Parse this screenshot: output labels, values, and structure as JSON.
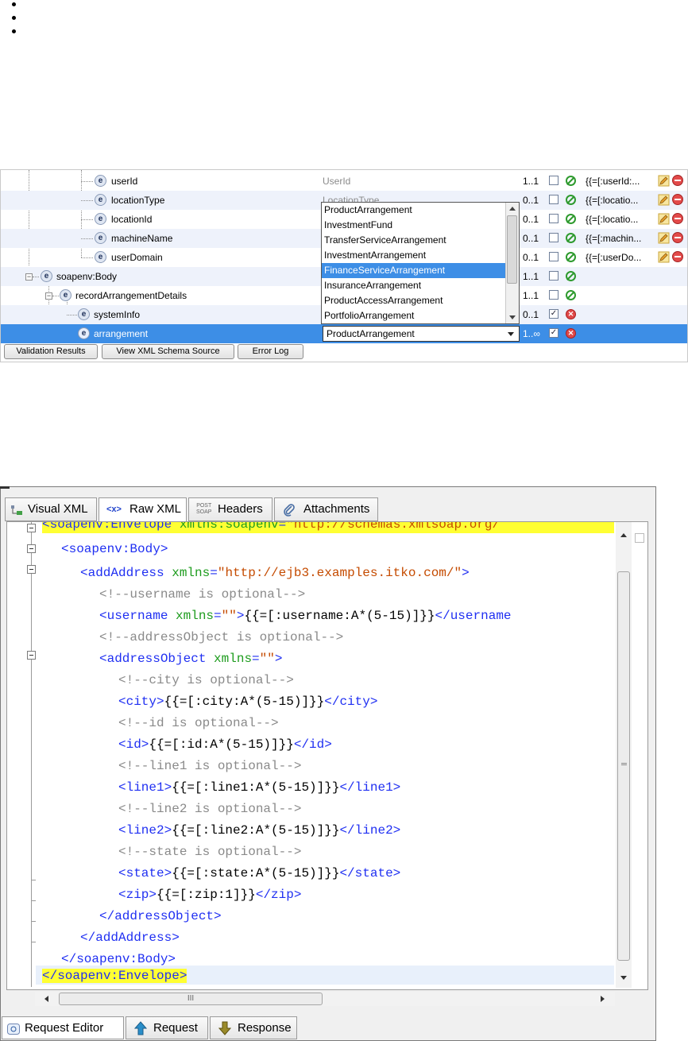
{
  "tree": {
    "rows": [
      {
        "name": "userId",
        "type": "UserId",
        "card": "1..1",
        "checked": false,
        "status": "ok",
        "value": "{{=[:userId:..."
      },
      {
        "name": "locationType",
        "type": "LocationType",
        "card": "0..1",
        "checked": false,
        "status": "ok",
        "value": "{{=[:locatio..."
      },
      {
        "name": "locationId",
        "type": "",
        "card": "0..1",
        "checked": false,
        "status": "ok",
        "value": "{{=[:locatio..."
      },
      {
        "name": "machineName",
        "type": "",
        "card": "0..1",
        "checked": false,
        "status": "ok",
        "value": "{{=[:machin..."
      },
      {
        "name": "userDomain",
        "type": "",
        "card": "0..1",
        "checked": false,
        "status": "ok",
        "value": "{{=[:userDo..."
      },
      {
        "name": "soapenv:Body",
        "type": "",
        "card": "1..1",
        "checked": false,
        "status": "ok",
        "value": ""
      },
      {
        "name": "recordArrangementDetails",
        "type": "",
        "card": "1..1",
        "checked": false,
        "status": "ok",
        "value": ""
      },
      {
        "name": "systemInfo",
        "type": "",
        "card": "0..1",
        "checked": true,
        "status": "error",
        "value": ""
      },
      {
        "name": "arrangement",
        "type": "",
        "card": "1..∞",
        "checked": true,
        "status": "error",
        "value": ""
      }
    ],
    "badge": "e",
    "dropdown": {
      "options": [
        "ProductArrangement",
        "InvestmentFund",
        "TransferServiceArrangement",
        "InvestmentArrangement",
        "FinanceServiceArrangement",
        "InsuranceArrangement",
        "ProductAccessArrangement",
        "PortfolioArrangement"
      ],
      "highlighted": "FinanceServiceArrangement",
      "selected": "ProductArrangement"
    },
    "buttons": {
      "validation": "Validation Results",
      "schema": "View XML Schema Source",
      "errorlog": "Error Log"
    }
  },
  "editor": {
    "tabs": {
      "visual": "Visual XML",
      "raw": "Raw XML",
      "headers": "Headers",
      "attachments": "Attachments",
      "raw_icon": "<x>",
      "headers_icon_top": "POST",
      "headers_icon_bottom": "SOAP"
    },
    "active_tab": "Raw XML",
    "lines": {
      "l1a": "<soapenv:Envelope ",
      "l1b": "xmlns:soapenv",
      "l1c": "=",
      "l1d": "\"http://schemas.xmlsoap.org/",
      "l2": "<soapenv:Body>",
      "l3a": "<addAddress ",
      "l3b": "xmlns",
      "l3c": "=",
      "l3d": "\"http://ejb3.examples.itko.com/\"",
      "l3e": ">",
      "l4": "<!--username is optional-->",
      "l5a": "<username ",
      "l5b": "xmlns",
      "l5c": "=",
      "l5d": "\"\"",
      "l5e": ">",
      "l5f": "{{=[:username:A*(5-15)]}}",
      "l5g": "</username",
      "l6": "<!--addressObject is optional-->",
      "l7a": "<addressObject ",
      "l7b": "xmlns",
      "l7c": "=",
      "l7d": "\"\"",
      "l7e": ">",
      "l8": "<!--city is optional-->",
      "l9a": "<city>",
      "l9b": "{{=[:city:A*(5-15)]}}",
      "l9c": "</city>",
      "l10": "<!--id is optional-->",
      "l11a": "<id>",
      "l11b": "{{=[:id:A*(5-15)]}}",
      "l11c": "</id>",
      "l12": "<!--line1 is optional-->",
      "l13a": "<line1>",
      "l13b": "{{=[:line1:A*(5-15)]}}",
      "l13c": "</line1>",
      "l14": "<!--line2 is optional-->",
      "l15a": "<line2>",
      "l15b": "{{=[:line2:A*(5-15)]}}",
      "l15c": "</line2>",
      "l16": "<!--state is optional-->",
      "l17a": "<state>",
      "l17b": "{{=[:state:A*(5-15)]}}",
      "l17c": "</state>",
      "l18a": "<zip>",
      "l18b": "{{=[:zip:1]}}",
      "l18c": "</zip>",
      "l19": "</addressObject>",
      "l20": "</addAddress>",
      "l21": "</soapenv:Body>",
      "l22": "</soapenv:Envelope>"
    },
    "hscroll_grip": "III",
    "bottom_tabs": {
      "request_editor": "Request Editor",
      "request": "Request",
      "response": "Response"
    }
  },
  "colors": {
    "selection": "#3d8ee6",
    "highlight_line": "#ffff33",
    "tag": "#1f2ff2",
    "attr": "#1e9c1e",
    "attr_value": "#c54b00",
    "comment": "#8a8a8a"
  }
}
